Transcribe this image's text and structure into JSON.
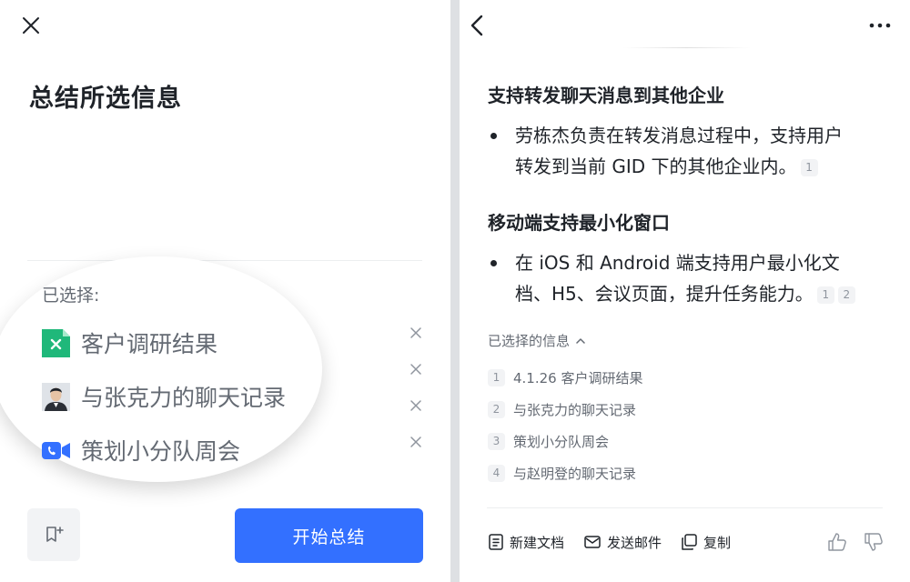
{
  "left": {
    "title": "总结所选信息",
    "selected_label": "已选择:",
    "items": [
      {
        "label": "客户调研结果",
        "icon": "doc-icon"
      },
      {
        "label": "与张克力的聊天记录",
        "icon": "avatar"
      },
      {
        "label": "策划小分队周会",
        "icon": "video-meeting-icon"
      }
    ],
    "start_button": "开始总结"
  },
  "right": {
    "sections": [
      {
        "title": "支持转发聊天消息到其他企业",
        "line1": "劳栋杰负责在转发消息过程中，支持用户",
        "line2": "转发到当前 GID 下的其他企业内。",
        "refs": [
          "1"
        ]
      },
      {
        "title": "移动端支持最小化窗口",
        "line1": "在 iOS 和 Android 端支持用户最小化文",
        "line2": "档、H5、会议页面，提升任务能力。",
        "refs": [
          "1",
          "2"
        ]
      }
    ],
    "selected_toggle": "已选择的信息",
    "sources": [
      {
        "num": "1",
        "label": "4.1.26 客户调研结果"
      },
      {
        "num": "2",
        "label": "与张克力的聊天记录"
      },
      {
        "num": "3",
        "label": "策划小分队周会"
      },
      {
        "num": "4",
        "label": "与赵明登的聊天记录"
      }
    ],
    "actions": {
      "new_doc": "新建文档",
      "send_mail": "发送邮件",
      "copy": "复制"
    }
  },
  "colors": {
    "accent": "#3370ff",
    "doc_icon": "#1fb87a",
    "meeting_icon": "#3370ff"
  }
}
